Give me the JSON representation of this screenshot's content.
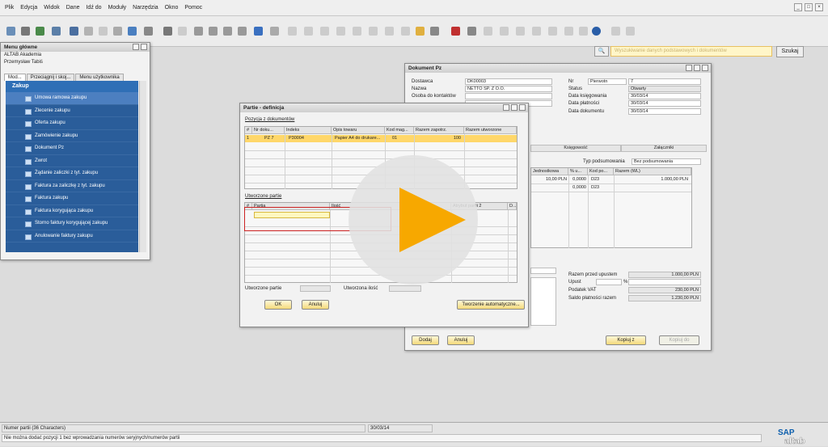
{
  "menubar": {
    "items": [
      "Plik",
      "Edycja",
      "Widok",
      "Dane",
      "Idź do",
      "Moduły",
      "Narzędzia",
      "Okno",
      "Pomoc"
    ]
  },
  "search": {
    "placeholder": "Wyszukiwanie danych podstawowych i dokumentów",
    "button": "Szukaj"
  },
  "main_menu": {
    "title": "Menu główne",
    "company": "ALTAB Akademia",
    "user": "Przemysław Tabiś",
    "tabs": [
      "Mod...",
      "Przeciągnij i skoj...",
      "Menu użytkownika"
    ],
    "section": "Zakup",
    "items": [
      "Umowa ramowa zakupu",
      "Zlecenie zakupu",
      "Oferta zakupu",
      "Zamówienie zakupu",
      "Dokument Pz",
      "Zwrot",
      "Żądanie zaliczki z tyt. zakupu",
      "Faktura za zaliczkę z tyt. zakupu",
      "Faktura zakupu",
      "Faktura korygująca zakupu",
      "Storno faktury korygującej zakupu",
      "Anulowanie faktury zakupu"
    ]
  },
  "dokument_pz": {
    "title": "Dokument Pz",
    "labels": {
      "dostawca": "Dostawca",
      "nazwa": "Nazwa",
      "osoba": "Osoba do kontaktów",
      "nr": "Nr",
      "status": "Status",
      "data_ksieg": "Data księgowania",
      "data_platn": "Data płatności",
      "data_dok": "Data dokumentu"
    },
    "values": {
      "dostawca": "DK00003",
      "nazwa": "NETTO SP. Z O.O.",
      "nr_series": "Pierwotn",
      "nr": "7",
      "status": "Otwarty",
      "data_ksieg": "30/03/14",
      "data_platn": "30/03/14",
      "data_dok": "30/03/14"
    },
    "tabs": [
      "Księgowość",
      "Załączniki"
    ],
    "typ_label": "Typ podsumowania",
    "typ_value": "Bez podsumowania",
    "cols": [
      "Jednostkowa",
      "% u...",
      "Kod po...",
      "Razem (WL)"
    ],
    "rows": [
      [
        "10,00 PLN",
        "0,0000",
        "D23",
        "1.000,00 PLN"
      ],
      [
        "",
        "0,0000",
        "D23",
        ""
      ]
    ],
    "totals": {
      "razem_label": "Razem przed upustem",
      "razem": "1.000,00 PLN",
      "upust_label": "Upust",
      "upust_pct": "%",
      "vat_label": "Podatek VAT",
      "vat": "230,00 PLN",
      "saldo_label": "Saldo płatności razem",
      "saldo": "1.230,00 PLN"
    },
    "buttons": {
      "dodaj": "Dodaj",
      "anuluj": "Anuluj",
      "kopiuj_z": "Kopiuj z",
      "kopiuj_do": "Kopiuj do"
    }
  },
  "partie": {
    "title": "Partie - definicja",
    "section1": "Pozycja z dokumentów",
    "cols1": [
      "#",
      "Nr doku...",
      "Indeks",
      "Opis towaru",
      "Kod mag...",
      "Razem zapotrz.",
      "Razem utworzone"
    ],
    "row1": [
      "1",
      "PZ 7",
      "P30004",
      "Papier A4 do drukare...",
      "01",
      "100",
      ""
    ],
    "section2": "Utworzone partie",
    "cols2": [
      "#",
      "Partia",
      "Ilość",
      "Atrybut partii 2",
      "D..."
    ],
    "footer": {
      "utworzone_label": "Utworzone partie",
      "ilosc_label": "Utworzona ilość"
    },
    "buttons": {
      "ok": "OK",
      "anuluj": "Anuluj",
      "auto": "Tworzenie automatyczne..."
    }
  },
  "status": {
    "field": "Numer partii (36 Characters)",
    "date": "30/03/14",
    "message": "Nie można dodać pozycji 1 bez wprowadzania numerów seryjnych/numerów partii"
  },
  "logo": {
    "text": "SAP",
    "sub": "altab"
  },
  "colors": {
    "accent": "#f7a800",
    "menu_blue": "#2a5d9a",
    "selected_row": "#ffd76a"
  }
}
